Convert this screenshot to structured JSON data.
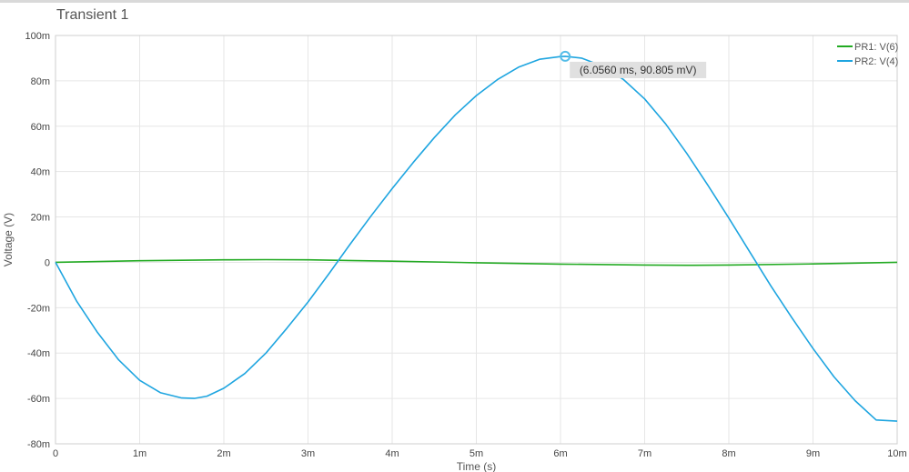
{
  "header": {
    "title": "Transient 1"
  },
  "chart_data": {
    "type": "line",
    "title": "Transient 1",
    "xlabel": "Time (s)",
    "ylabel": "Voltage (V)",
    "xlim": [
      0,
      10
    ],
    "ylim": [
      -80,
      100
    ],
    "x_unit_note": "ms",
    "grid": true,
    "legend_position": "top-right",
    "x_ticks": [
      {
        "value": 0,
        "label": "0"
      },
      {
        "value": 1,
        "label": "1m"
      },
      {
        "value": 2,
        "label": "2m"
      },
      {
        "value": 3,
        "label": "3m"
      },
      {
        "value": 4,
        "label": "4m"
      },
      {
        "value": 5,
        "label": "5m"
      },
      {
        "value": 6,
        "label": "6m"
      },
      {
        "value": 7,
        "label": "7m"
      },
      {
        "value": 8,
        "label": "8m"
      },
      {
        "value": 9,
        "label": "9m"
      },
      {
        "value": 10,
        "label": "10m"
      }
    ],
    "y_ticks": [
      {
        "value": 100,
        "label": "100m"
      },
      {
        "value": 80,
        "label": "80m"
      },
      {
        "value": 60,
        "label": "60m"
      },
      {
        "value": 40,
        "label": "40m"
      },
      {
        "value": 20,
        "label": "20m"
      },
      {
        "value": 0,
        "label": "0"
      },
      {
        "value": -20,
        "label": "-20m"
      },
      {
        "value": -40,
        "label": "-40m"
      },
      {
        "value": -60,
        "label": "-60m"
      },
      {
        "value": -80,
        "label": "-80m"
      }
    ],
    "series": [
      {
        "name": "PR1: V(6)",
        "color": "#22aa22",
        "x": [
          0,
          1,
          2,
          2.5,
          3,
          4,
          5,
          6,
          7,
          7.5,
          8,
          9,
          10
        ],
        "y": [
          0,
          0.7,
          1.1,
          1.2,
          1.1,
          0.5,
          -0.2,
          -0.8,
          -1.2,
          -1.3,
          -1.2,
          -0.7,
          0
        ]
      },
      {
        "name": "PR2: V(4)",
        "color": "#1ea5e0",
        "x": [
          0,
          0.25,
          0.5,
          0.75,
          1.0,
          1.25,
          1.5,
          1.65,
          1.8,
          2.0,
          2.25,
          2.5,
          2.75,
          3.0,
          3.25,
          3.5,
          3.75,
          4.0,
          4.25,
          4.5,
          4.75,
          5.0,
          5.25,
          5.5,
          5.75,
          6.0,
          6.056,
          6.25,
          6.5,
          6.75,
          7.0,
          7.25,
          7.5,
          7.75,
          8.0,
          8.25,
          8.5,
          8.75,
          9.0,
          9.25,
          9.5,
          9.75,
          10.0
        ],
        "y": [
          0,
          -17,
          -31,
          -43,
          -52,
          -57.5,
          -59.8,
          -60,
          -59,
          -55.5,
          -49,
          -40,
          -29,
          -17.5,
          -5,
          8,
          20.5,
          32.5,
          44,
          55,
          65,
          73.5,
          80.5,
          86,
          89.5,
          90.7,
          90.805,
          90,
          86.5,
          80.5,
          72,
          61,
          48,
          34,
          19.5,
          4.5,
          -10.5,
          -24.5,
          -38,
          -50.5,
          -61,
          -69.5,
          -70
        ]
      }
    ],
    "marker": {
      "series": "PR2: V(4)",
      "x": 6.056,
      "y": 90.805,
      "label": "(6.0560 ms, 90.805 mV)"
    }
  }
}
